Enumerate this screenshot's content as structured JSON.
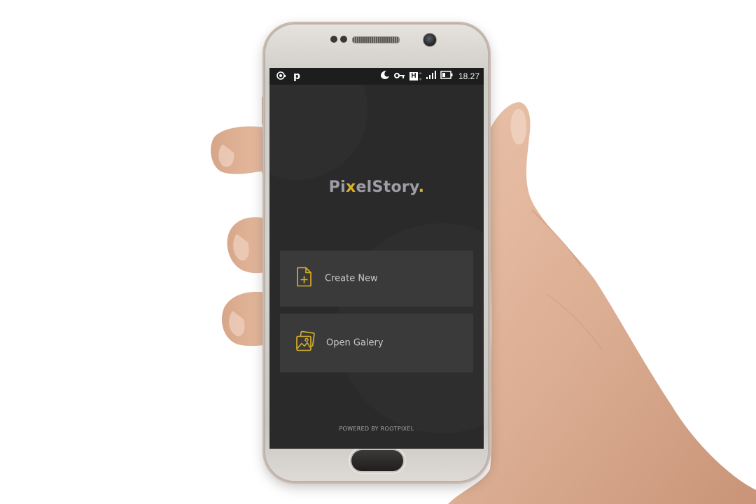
{
  "status_bar": {
    "left_icons": [
      "eye-notification-icon",
      "p-app-icon"
    ],
    "p_label": "p",
    "right_icons": [
      "moon-icon",
      "key-icon",
      "h-signal-icon",
      "signal-bars-icon",
      "battery-icon"
    ],
    "h_label": "H",
    "time": "18.27"
  },
  "logo": {
    "part1": "Pi",
    "accent_x": "x",
    "part2": "elStory",
    "accent_dot": "."
  },
  "menu": {
    "items": [
      {
        "label": "Create New",
        "icon": "file-plus-icon"
      },
      {
        "label": "Open Galery",
        "icon": "gallery-icon"
      }
    ]
  },
  "footer": {
    "text": "POWERED BY ROOTPIXEL"
  },
  "colors": {
    "screen_bg": "#2a2a2a",
    "card_bg": "#3a3a3a",
    "accent": "#d9b22a",
    "logo_text": "#9d9ea6"
  }
}
